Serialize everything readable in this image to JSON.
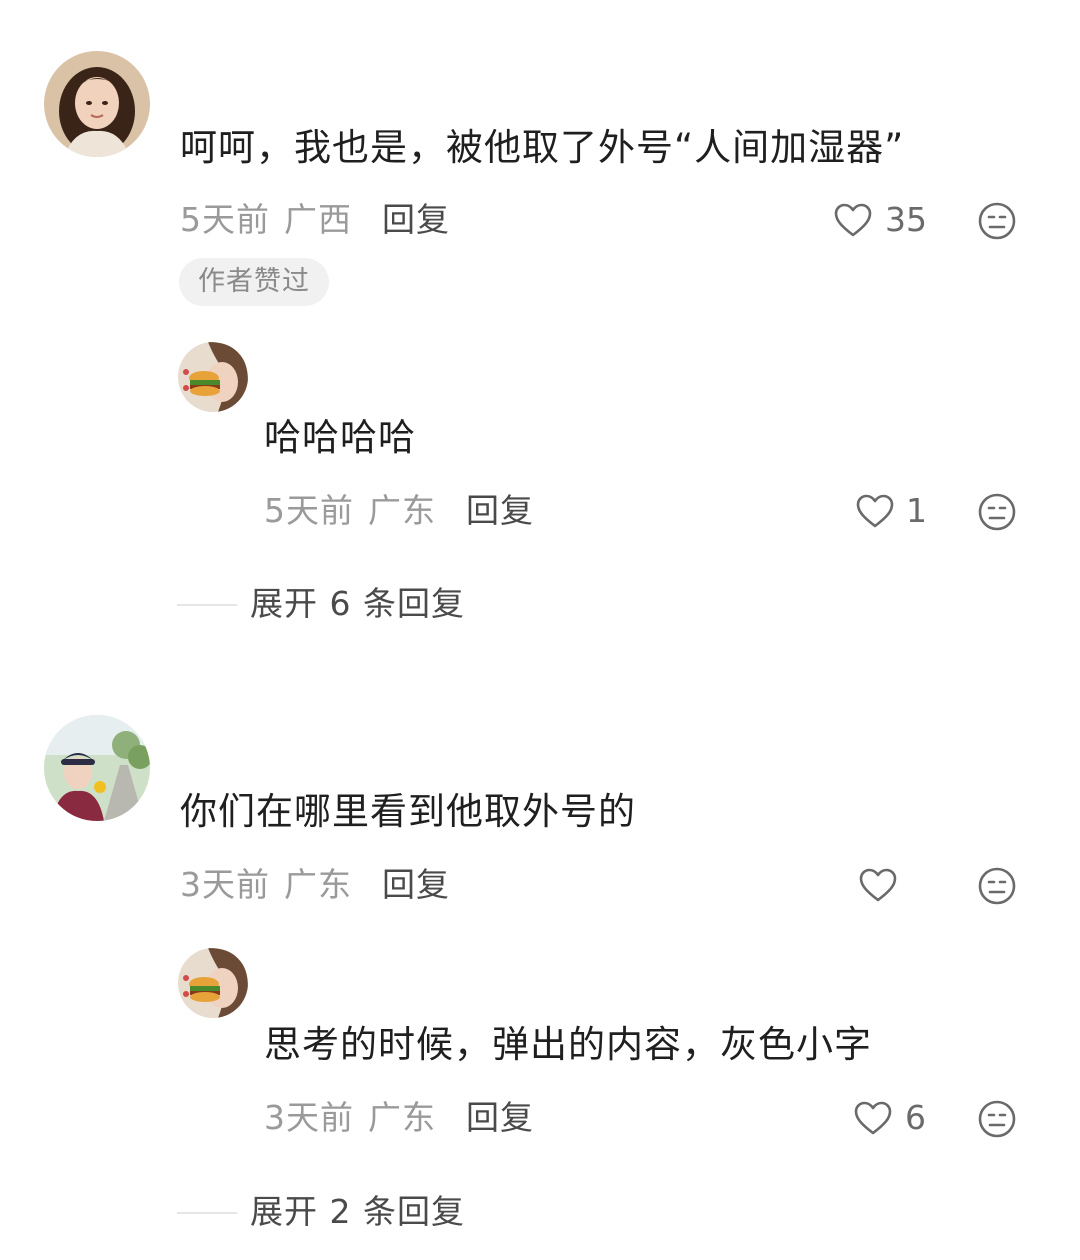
{
  "comments": [
    {
      "text": "呵呵，我也是，被他取了外号“人间加湿器”",
      "time": "5天前",
      "location": "广西",
      "reply_label": "回复",
      "likes": "35",
      "badge": "作者赞过",
      "replies": [
        {
          "text": "哈哈哈哈",
          "time": "5天前",
          "location": "广东",
          "reply_label": "回复",
          "likes": "1"
        }
      ],
      "expand_label": "展开 6 条回复"
    },
    {
      "text": "你们在哪里看到他取外号的",
      "time": "3天前",
      "location": "广东",
      "reply_label": "回复",
      "likes": "",
      "replies": [
        {
          "text": "思考的时候，弹出的内容，灰色小字",
          "time": "3天前",
          "location": "广东",
          "reply_label": "回复",
          "likes": "6"
        }
      ],
      "expand_label": "展开 2 条回复"
    }
  ],
  "icons": {
    "like": "heart-outline-icon",
    "dislike": "meh-face-icon"
  },
  "colors": {
    "text_primary": "#1f1f1f",
    "text_meta": "#9a9a9a",
    "text_action": "#4a4a4a",
    "badge_bg": "#f1f1f1"
  }
}
